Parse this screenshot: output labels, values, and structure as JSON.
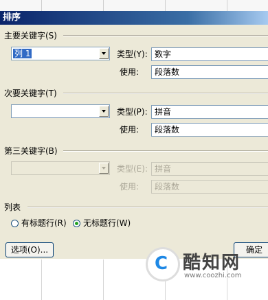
{
  "dialog": {
    "title": "排序"
  },
  "primary": {
    "group_label": "主要关键字(S)",
    "combo_value": "列 1",
    "type_label": "类型(Y):",
    "type_value": "数字",
    "using_label": "使用:",
    "using_value": "段落数"
  },
  "secondary": {
    "group_label": "次要关键字(T)",
    "combo_value": "",
    "type_label": "类型(P):",
    "type_value": "拼音",
    "using_label": "使用:",
    "using_value": "段落数"
  },
  "tertiary": {
    "group_label": "第三关键字(B)",
    "combo_value": "",
    "type_label": "类型(E):",
    "type_value": "拼音",
    "using_label": "使用:",
    "using_value": "段落数"
  },
  "list": {
    "group_label": "列表",
    "radio_header_label": "有标题行(R)",
    "radio_no_header_label": "无标题行(W)",
    "selected": "no_header"
  },
  "buttons": {
    "options": "选项(O)...",
    "ok": "确定"
  },
  "watermark": {
    "brand": "酷知网",
    "url": "www.coozhi.com",
    "logo_letter": "C"
  },
  "colors": {
    "title_start": "#0a246a",
    "title_end": "#a6caf0",
    "dialog_bg": "#ece9d8",
    "selection": "#316ac5"
  }
}
